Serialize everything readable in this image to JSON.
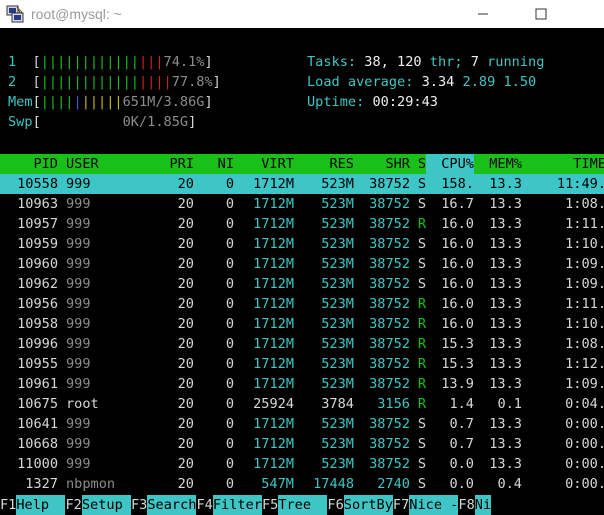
{
  "window": {
    "title": "root@mysql: ~",
    "minimize_glyph": "—",
    "maximize_glyph": "☐",
    "close_glyph": "✕"
  },
  "meters": {
    "cpu1": {
      "label": "1",
      "bars_green": "||||||||||||",
      "bars_red": "|||",
      "value": "74.1%"
    },
    "cpu2": {
      "label": "2",
      "bars_green": "||||||||||||",
      "bars_red": "||||",
      "value": "77.8%"
    },
    "mem": {
      "label": "Mem",
      "bars_green": "||||",
      "bars_blue": "|",
      "bars_yellow": "|||||",
      "value": "651M/3.86G"
    },
    "swp": {
      "label": "Swp",
      "value": "0K/1.85G"
    }
  },
  "summary": {
    "tasks_label": "Tasks:",
    "tasks_value": "38,",
    "thr_value": "120",
    "thr_label": "thr;",
    "running_value": "7",
    "running_label": "running",
    "load_label": "Load average:",
    "load_1": "3.34",
    "load_5": "2.89",
    "load_15": "1.50",
    "uptime_label": "Uptime:",
    "uptime_value": "00:29:43"
  },
  "columns": {
    "pid": "PID",
    "user": "USER",
    "pri": "PRI",
    "ni": "NI",
    "virt": "VIRT",
    "res": "RES",
    "shr": "SHR",
    "s": "S",
    "cpu": "CPU%",
    "mem": "MEM%",
    "time": "TIME"
  },
  "processes": [
    {
      "pid": "10558",
      "user": "999",
      "pri": "20",
      "ni": "0",
      "virt": "1712M",
      "res": "523M",
      "shr": "38752",
      "s": "S",
      "cpu": "158.",
      "mem": "13.3",
      "time": "11:49."
    },
    {
      "pid": "10963",
      "user": "999",
      "pri": "20",
      "ni": "0",
      "virt": "1712M",
      "res": "523M",
      "shr": "38752",
      "s": "S",
      "cpu": "16.7",
      "mem": "13.3",
      "time": "1:08."
    },
    {
      "pid": "10957",
      "user": "999",
      "pri": "20",
      "ni": "0",
      "virt": "1712M",
      "res": "523M",
      "shr": "38752",
      "s": "R",
      "cpu": "16.0",
      "mem": "13.3",
      "time": "1:11."
    },
    {
      "pid": "10959",
      "user": "999",
      "pri": "20",
      "ni": "0",
      "virt": "1712M",
      "res": "523M",
      "shr": "38752",
      "s": "S",
      "cpu": "16.0",
      "mem": "13.3",
      "time": "1:10."
    },
    {
      "pid": "10960",
      "user": "999",
      "pri": "20",
      "ni": "0",
      "virt": "1712M",
      "res": "523M",
      "shr": "38752",
      "s": "S",
      "cpu": "16.0",
      "mem": "13.3",
      "time": "1:09."
    },
    {
      "pid": "10962",
      "user": "999",
      "pri": "20",
      "ni": "0",
      "virt": "1712M",
      "res": "523M",
      "shr": "38752",
      "s": "S",
      "cpu": "16.0",
      "mem": "13.3",
      "time": "1:09."
    },
    {
      "pid": "10956",
      "user": "999",
      "pri": "20",
      "ni": "0",
      "virt": "1712M",
      "res": "523M",
      "shr": "38752",
      "s": "R",
      "cpu": "16.0",
      "mem": "13.3",
      "time": "1:11."
    },
    {
      "pid": "10958",
      "user": "999",
      "pri": "20",
      "ni": "0",
      "virt": "1712M",
      "res": "523M",
      "shr": "38752",
      "s": "R",
      "cpu": "16.0",
      "mem": "13.3",
      "time": "1:10."
    },
    {
      "pid": "10996",
      "user": "999",
      "pri": "20",
      "ni": "0",
      "virt": "1712M",
      "res": "523M",
      "shr": "38752",
      "s": "R",
      "cpu": "15.3",
      "mem": "13.3",
      "time": "1:08."
    },
    {
      "pid": "10955",
      "user": "999",
      "pri": "20",
      "ni": "0",
      "virt": "1712M",
      "res": "523M",
      "shr": "38752",
      "s": "R",
      "cpu": "15.3",
      "mem": "13.3",
      "time": "1:12."
    },
    {
      "pid": "10961",
      "user": "999",
      "pri": "20",
      "ni": "0",
      "virt": "1712M",
      "res": "523M",
      "shr": "38752",
      "s": "R",
      "cpu": "13.9",
      "mem": "13.3",
      "time": "1:09."
    },
    {
      "pid": "10675",
      "user": "root",
      "pri": "20",
      "ni": "0",
      "virt": "25924",
      "res": "3784",
      "shr": "3156",
      "s": "R",
      "cpu": "1.4",
      "mem": "0.1",
      "time": "0:04."
    },
    {
      "pid": "10641",
      "user": "999",
      "pri": "20",
      "ni": "0",
      "virt": "1712M",
      "res": "523M",
      "shr": "38752",
      "s": "S",
      "cpu": "0.7",
      "mem": "13.3",
      "time": "0:00."
    },
    {
      "pid": "10668",
      "user": "999",
      "pri": "20",
      "ni": "0",
      "virt": "1712M",
      "res": "523M",
      "shr": "38752",
      "s": "S",
      "cpu": "0.7",
      "mem": "13.3",
      "time": "0:00."
    },
    {
      "pid": "11000",
      "user": "999",
      "pri": "20",
      "ni": "0",
      "virt": "1712M",
      "res": "523M",
      "shr": "38752",
      "s": "S",
      "cpu": "0.0",
      "mem": "13.3",
      "time": "0:00."
    },
    {
      "pid": "1327",
      "user": "nbpmon",
      "pri": "20",
      "ni": "0",
      "virt": "547M",
      "res": "17448",
      "shr": "2740",
      "s": "S",
      "cpu": "0.0",
      "mem": "0.4",
      "time": "0:00."
    }
  ],
  "fkeys": [
    {
      "num": "F1",
      "label": "Help  "
    },
    {
      "num": "F2",
      "label": "Setup "
    },
    {
      "num": "F3",
      "label": "Search"
    },
    {
      "num": "F4",
      "label": "Filter"
    },
    {
      "num": "F5",
      "label": "Tree  "
    },
    {
      "num": "F6",
      "label": "SortBy"
    },
    {
      "num": "F7",
      "label": "Nice -"
    },
    {
      "num": "F8",
      "label": "Ni"
    }
  ]
}
